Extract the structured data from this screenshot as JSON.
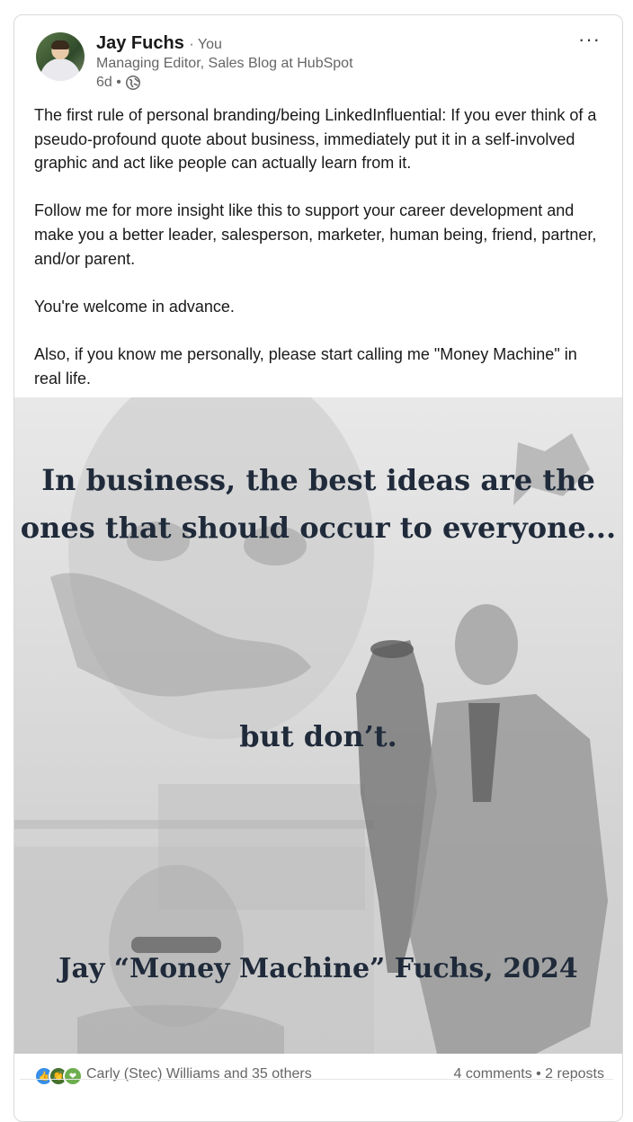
{
  "author": {
    "name": "Jay Fuchs",
    "you_label": "· You",
    "headline": "Managing Editor, Sales Blog at HubSpot",
    "time": "6d •"
  },
  "menu_label": "···",
  "post": {
    "paragraphs": [
      "The first rule of personal branding/being LinkedInfluential: If you ever think of a pseudo-profound quote about business, immediately put it in a self-involved graphic and act like people can actually learn from it.",
      "Follow me for more insight like this to support your career development and make you a better leader, salesperson, marketer, human being, friend, partner, and/or parent.",
      "You're welcome in advance.",
      "Also, if you know me personally, please start calling me \"Money Machine\" in real life."
    ]
  },
  "image": {
    "line1": "In business, the best ideas are the ones that should occur to everyone...",
    "line2": "but don’t.",
    "line3": "Jay “Money Machine” Fuchs, 2024"
  },
  "social": {
    "reactors": "Carly (Stec) Williams and 35 others",
    "stats": "4 comments • 2 reposts"
  },
  "colors": {
    "like": "#378fe9",
    "celebrate": "#44712e",
    "support": "#6dae4f",
    "quote_text": "#1f2a3a"
  }
}
